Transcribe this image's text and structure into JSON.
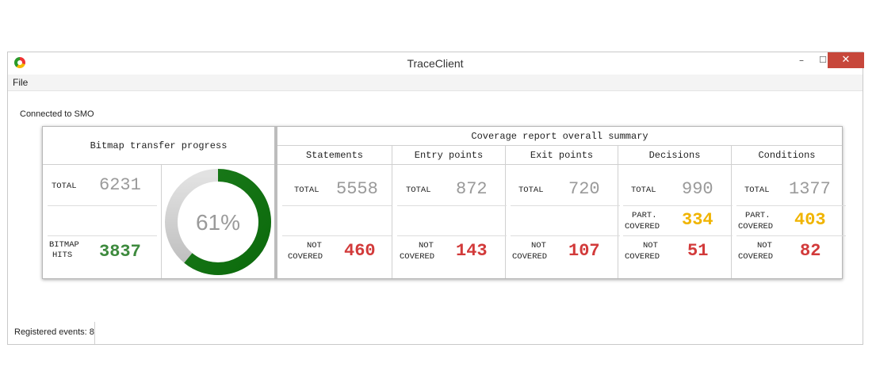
{
  "window": {
    "title": "TraceClient"
  },
  "menu": {
    "file": "File"
  },
  "window_controls": {
    "minimize": "–",
    "maximize": "☐",
    "close": "✕"
  },
  "status": {
    "connection": "Connected to SMO",
    "events": "Registered events: 8"
  },
  "bitmap": {
    "title": "Bitmap transfer progress",
    "total_label": "TOTAL",
    "total_value": "6231",
    "hits_label_1": "BITMAP",
    "hits_label_2": "HITS",
    "hits_value": "3837",
    "progress_label": "61%",
    "progress_fraction": 0.61
  },
  "coverage": {
    "title": "Coverage report overall summary",
    "columns": [
      {
        "name": "Statements",
        "total_label": "TOTAL",
        "total": "5558",
        "part_label_1": "",
        "part_label_2": "",
        "part": "",
        "not_label_1": "NOT",
        "not_label_2": "COVERED",
        "not_covered": "460"
      },
      {
        "name": "Entry points",
        "total_label": "TOTAL",
        "total": "872",
        "part_label_1": "",
        "part_label_2": "",
        "part": "",
        "not_label_1": "NOT",
        "not_label_2": "COVERED",
        "not_covered": "143"
      },
      {
        "name": "Exit points",
        "total_label": "TOTAL",
        "total": "720",
        "part_label_1": "",
        "part_label_2": "",
        "part": "",
        "not_label_1": "NOT",
        "not_label_2": "COVERED",
        "not_covered": "107"
      },
      {
        "name": "Decisions",
        "total_label": "TOTAL",
        "total": "990",
        "part_label_1": "PART.",
        "part_label_2": "COVERED",
        "part": "334",
        "not_label_1": "NOT",
        "not_label_2": "COVERED",
        "not_covered": "51"
      },
      {
        "name": "Conditions",
        "total_label": "TOTAL",
        "total": "1377",
        "part_label_1": "PART.",
        "part_label_2": "COVERED",
        "part": "403",
        "not_label_1": "NOT",
        "not_label_2": "COVERED",
        "not_covered": "82"
      }
    ]
  },
  "colors": {
    "green": "#2f8f2f",
    "red": "#d23a3a",
    "yellow": "#f0b400",
    "gray": "#9a9a9a",
    "close": "#c7473b"
  }
}
